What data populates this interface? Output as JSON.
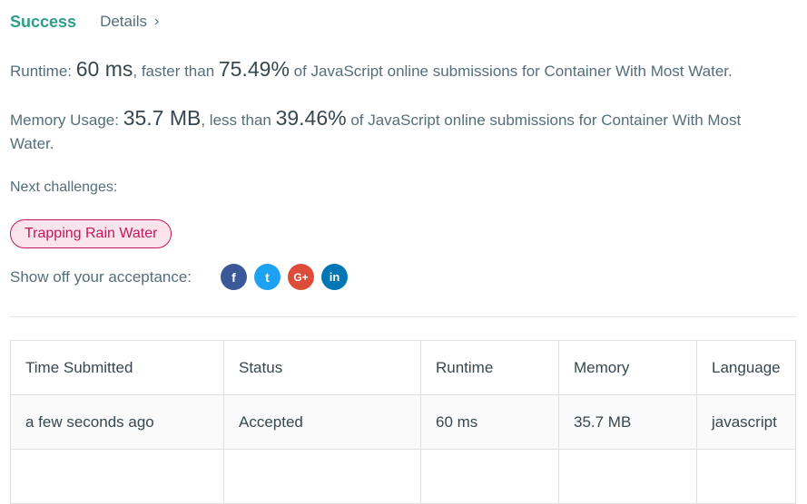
{
  "header": {
    "success": "Success",
    "details": "Details"
  },
  "runtime": {
    "label": "Runtime: ",
    "value": "60 ms",
    "mid": ", faster than ",
    "percent": "75.49%",
    "tail": " of JavaScript online submissions for Container With Most Water."
  },
  "memory": {
    "label": "Memory Usage: ",
    "value": "35.7 MB",
    "mid": ", less than ",
    "percent": "39.46%",
    "tail": " of JavaScript online submissions for Container With Most Water."
  },
  "next": {
    "label": "Next challenges:",
    "tags": [
      "Trapping Rain Water"
    ]
  },
  "share": {
    "label": "Show off your acceptance:",
    "icons": [
      "facebook-icon",
      "twitter-icon",
      "google-plus-icon",
      "linkedin-icon"
    ],
    "glyphs": [
      "f",
      "t",
      "G+",
      "in"
    ]
  },
  "colors": {
    "accent": "#2e9e8a",
    "tag": "#c2185b",
    "facebook": "#3b5998",
    "twitter": "#1da1f2",
    "google": "#dd4b39",
    "linkedin": "#0077b5"
  },
  "table": {
    "headers": [
      "Time Submitted",
      "Status",
      "Runtime",
      "Memory",
      "Language"
    ],
    "rows": [
      [
        "a few seconds ago",
        "Accepted",
        "60 ms",
        "35.7 MB",
        "javascript"
      ]
    ]
  }
}
